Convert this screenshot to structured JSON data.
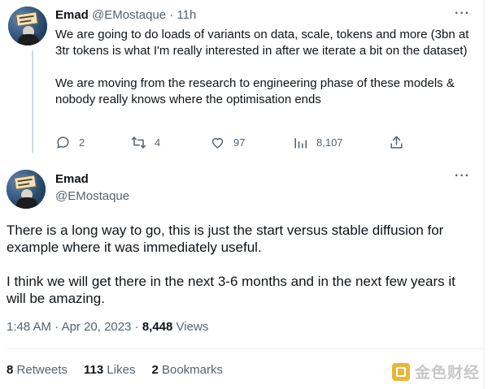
{
  "tweet1": {
    "name": "Emad",
    "handle": "@EMostaque",
    "separator": "·",
    "time": "11h",
    "more": "···",
    "text": [
      "We are going to do loads of variants on data, scale, tokens and more (3bn at 3tr tokens is what I'm really interested in after we iterate a bit on the dataset)",
      "We are moving from the research to engineering phase of these models & nobody really knows where the optimisation ends"
    ],
    "actions": {
      "replies": "2",
      "retweets": "4",
      "likes": "97",
      "views": "8,107"
    }
  },
  "tweet2": {
    "name": "Emad",
    "handle": "@EMostaque",
    "more": "···",
    "text": [
      "There is a long way to go, this is just the start versus stable diffusion for example where it was immediately useful.",
      "I think we will get there in the next 3-6 months and in the next few years it will be amazing."
    ],
    "time": "1:48 AM",
    "separator": "·",
    "date": "Apr 20, 2023",
    "views_count": "8,448",
    "views_label": "Views",
    "stats": {
      "retweets_count": "8",
      "retweets_label": "Retweets",
      "likes_count": "113",
      "likes_label": "Likes",
      "bookmarks_count": "2",
      "bookmarks_label": "Bookmarks"
    }
  },
  "watermark": {
    "text": "金色财经",
    "color": "#e9b638"
  },
  "icons": [
    "reply-icon",
    "retweet-icon",
    "like-icon",
    "views-icon",
    "share-icon",
    "more-icon"
  ],
  "colors": {
    "text": "#0f1419",
    "muted": "#536471",
    "line": "#cfd9de"
  }
}
